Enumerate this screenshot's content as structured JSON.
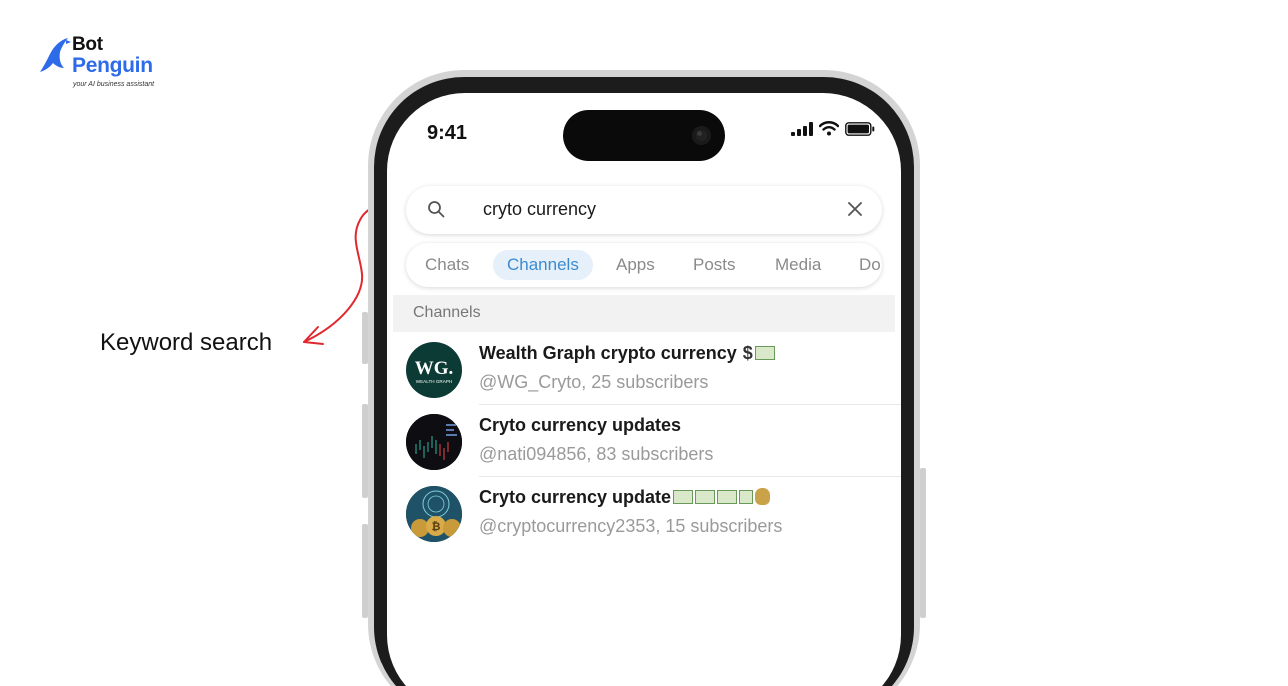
{
  "brand": {
    "name_line1": "Bot",
    "name_line2": "Penguin",
    "tagline": "your AI business assistant",
    "accent": "#2e6be8"
  },
  "annotation": {
    "label": "Keyword search",
    "arrow_color": "#e0282e"
  },
  "status_bar": {
    "time": "9:41",
    "icons": [
      "cellular-signal-icon",
      "wifi-icon",
      "battery-icon"
    ]
  },
  "search": {
    "query": "cryto currency",
    "icon": "search-icon",
    "clear_icon": "close-icon"
  },
  "tabs": {
    "items": [
      "Chats",
      "Channels",
      "Apps",
      "Posts",
      "Media",
      "Do"
    ],
    "active": "Channels",
    "active_color": "#3c8bd0"
  },
  "results": {
    "section_title": "Channels",
    "items": [
      {
        "title": "Wealth Graph crypto currency",
        "suffix": "$",
        "subtitle": "@WG_Cryto, 25 subscribers",
        "avatar_text": "WG.",
        "avatar_sub": "WEALTH GRAPH"
      },
      {
        "title": "Cryto currency updates",
        "subtitle": "@nati094856, 83 subscribers"
      },
      {
        "title": "Cryto currency update",
        "subtitle": "@cryptocurrency2353, 15 subscribers"
      }
    ]
  }
}
